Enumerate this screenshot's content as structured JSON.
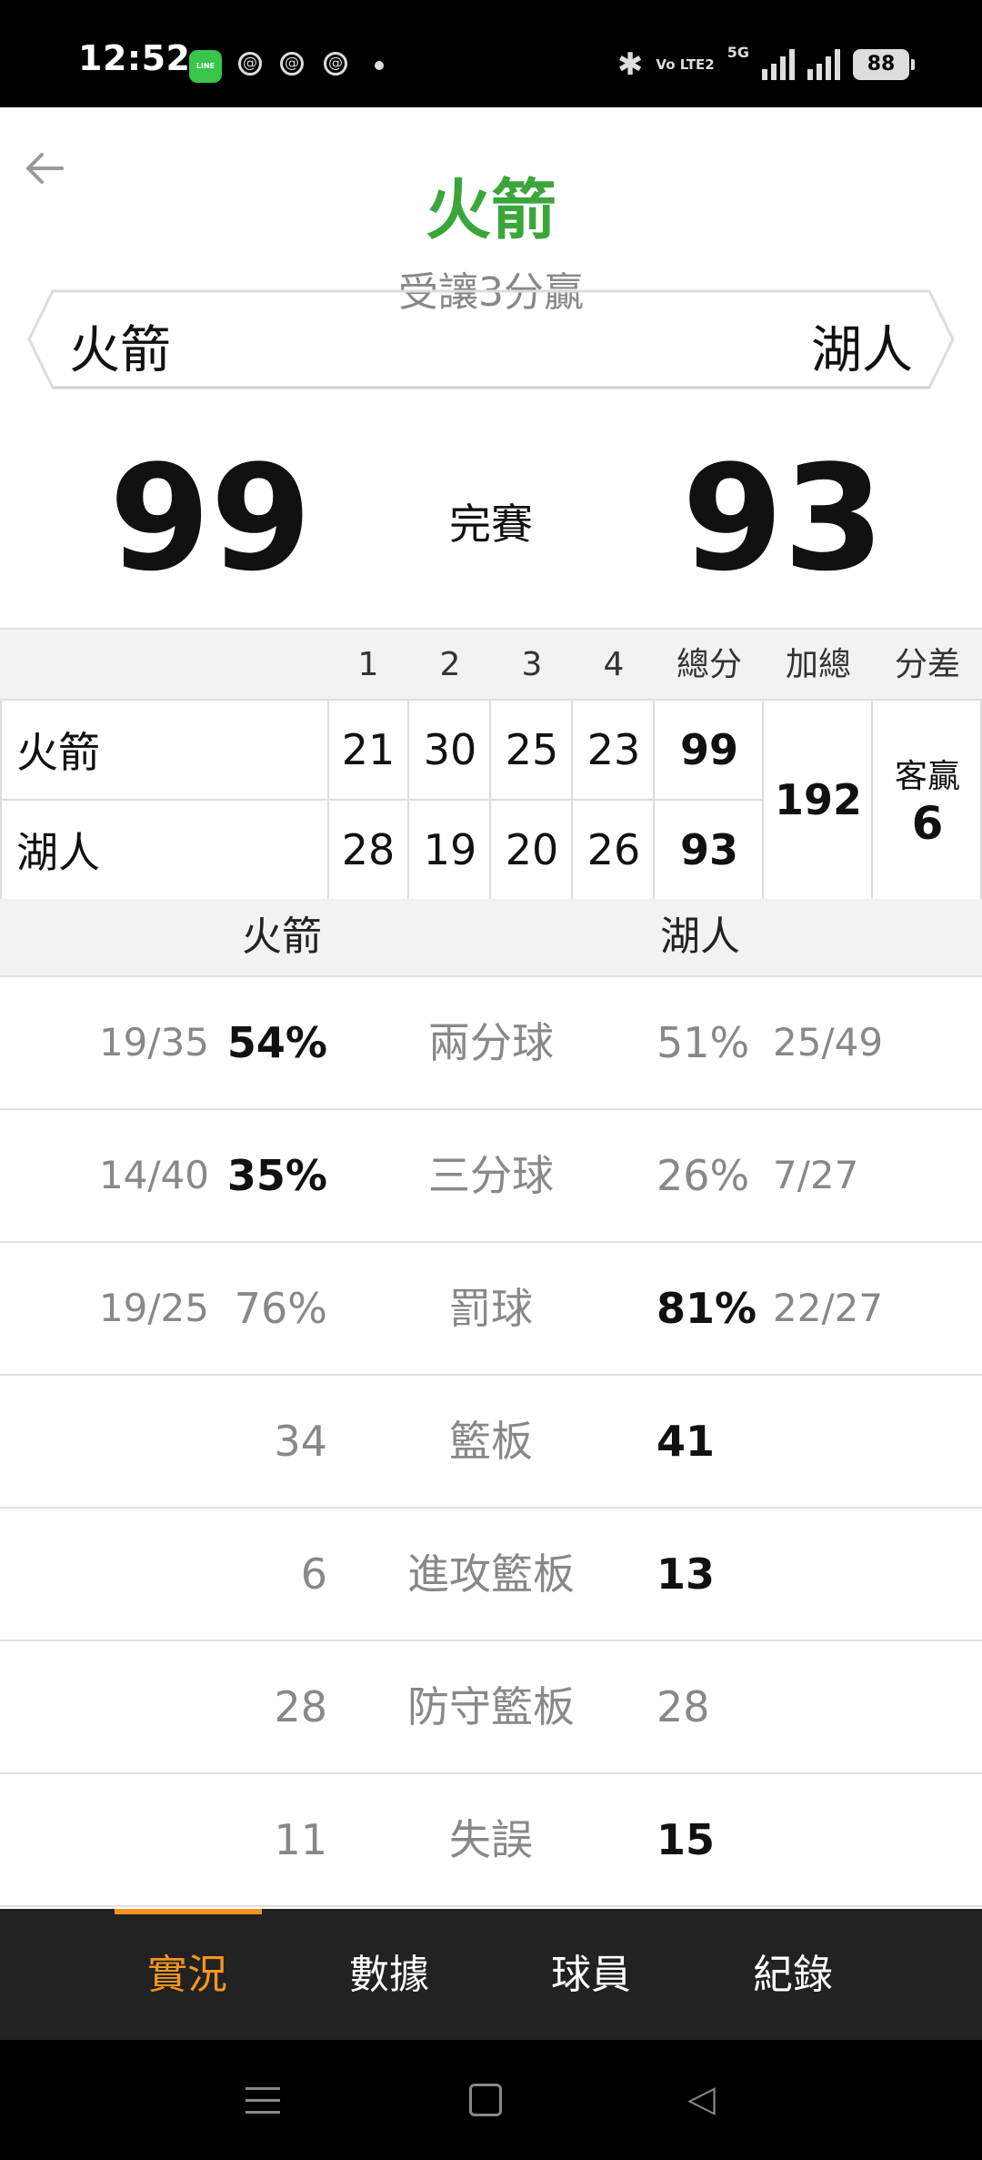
{
  "status_bar": {
    "time": "12:52",
    "network": "5G",
    "volte": "Vo LTE2",
    "battery": "88",
    "icons": [
      "line-icon",
      "threads-icon",
      "threads-icon",
      "threads-icon",
      "dot-icon",
      "bluetooth-icon",
      "volte-icon",
      "signal-icon",
      "signal-icon",
      "battery-icon"
    ]
  },
  "header": {
    "title": "火箭",
    "subtitle": "受讓3分贏",
    "home_team": "火箭",
    "away_team": "湖人"
  },
  "score": {
    "home": "99",
    "away": "93",
    "status": "完賽"
  },
  "quarters": {
    "headers": [
      "1",
      "2",
      "3",
      "4",
      "總分",
      "加總",
      "分差"
    ],
    "rows": [
      {
        "team": "火箭",
        "q": [
          "21",
          "30",
          "25",
          "23"
        ],
        "total": "99"
      },
      {
        "team": "湖人",
        "q": [
          "28",
          "19",
          "20",
          "26"
        ],
        "total": "93"
      }
    ],
    "sum": "192",
    "diff_label": "客贏",
    "diff_value": "6"
  },
  "stats": {
    "home_team": "火箭",
    "away_team": "湖人",
    "rows": [
      {
        "label": "兩分球",
        "home_frac": "19/35",
        "home": "54%",
        "away": "51%",
        "away_frac": "25/49",
        "leader": "home"
      },
      {
        "label": "三分球",
        "home_frac": "14/40",
        "home": "35%",
        "away": "26%",
        "away_frac": "7/27",
        "leader": "home"
      },
      {
        "label": "罰球",
        "home_frac": "19/25",
        "home": "76%",
        "away": "81%",
        "away_frac": "22/27",
        "leader": "away"
      },
      {
        "label": "籃板",
        "home_frac": "",
        "home": "34",
        "away": "41",
        "away_frac": "",
        "leader": "away"
      },
      {
        "label": "進攻籃板",
        "home_frac": "",
        "home": "6",
        "away": "13",
        "away_frac": "",
        "leader": "away"
      },
      {
        "label": "防守籃板",
        "home_frac": "",
        "home": "28",
        "away": "28",
        "away_frac": "",
        "leader": "none"
      },
      {
        "label": "失誤",
        "home_frac": "",
        "home": "11",
        "away": "15",
        "away_frac": "",
        "leader": "away"
      }
    ]
  },
  "tabs": [
    "實況",
    "數據",
    "球員",
    "紀錄"
  ],
  "active_tab": 0,
  "colors": {
    "title_green": "#3aa63a",
    "accent_orange": "#f39621",
    "tabbar": "#222222"
  }
}
